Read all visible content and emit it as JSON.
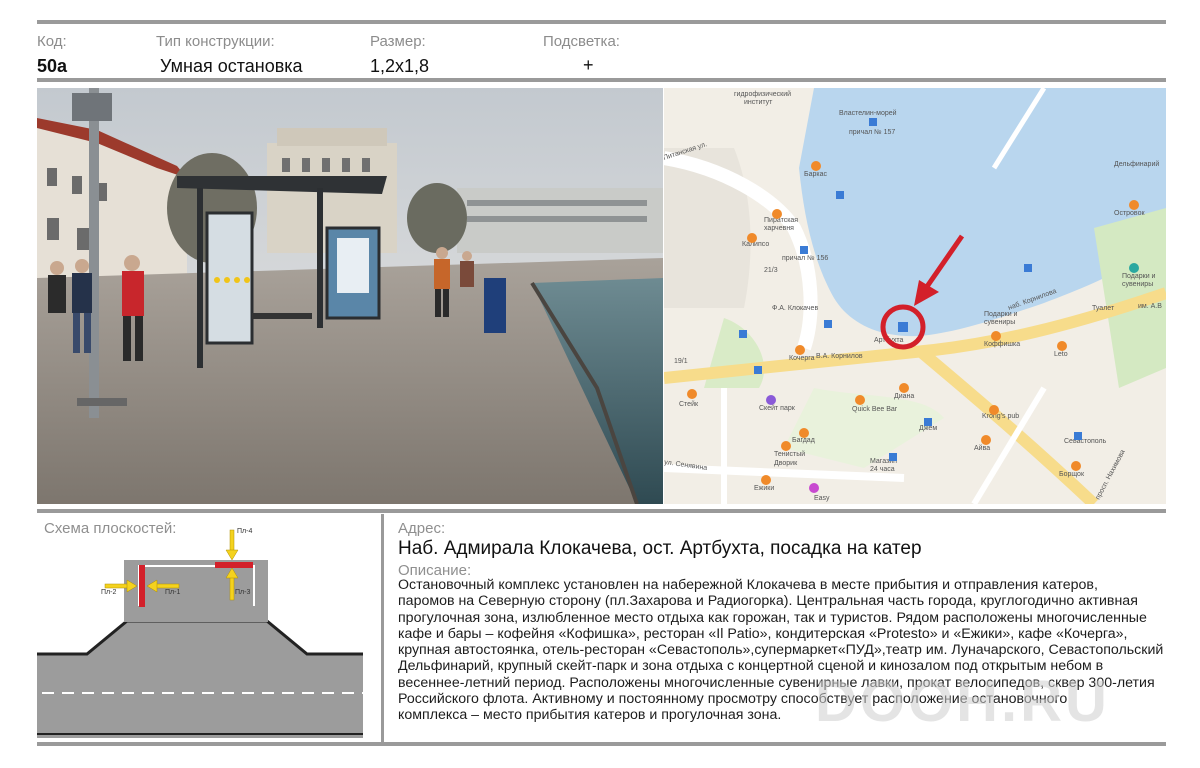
{
  "header": {
    "code_label": "Код:",
    "code_value": "50а",
    "type_label": "Тип конструкции:",
    "type_value": "Умная остановка",
    "size_label": "Размер:",
    "size_value": "1,2х1,8",
    "light_label": "Подсветка:",
    "light_value": "+"
  },
  "scheme": {
    "title": "Схема плоскостей:",
    "planes": [
      "Пл-1",
      "Пл-2",
      "Пл-3",
      "Пл-4"
    ]
  },
  "address": {
    "label": "Адрес:",
    "value": "Наб. Адмирала Клокачева, ост. Артбухта, посадка на катер"
  },
  "description": {
    "label": "Описание:",
    "lines": [
      "Остановочный  комплекс установлен  на набережной Клокачева в месте прибытия и отправления катеров,",
      "паромов на Северную сторону (пл.Захарова и Радиогорка). Центральная часть города,  круглогодично активная",
      "прогулочная зона, излюбленное место отдыха как горожан, так и туристов. Рядом расположены многочисленные",
      "кафе и бары – кофейня «Кофишка», ресторан «Il Patio», кондитерская «Protesto» и «Ежики», кафе «Кочерга»,",
      "крупная автостоянка, отель-ресторан «Севастополь»,супермаркет«ПУД»,театр им. Луначарского, Севастопольский",
      "Дельфинарий, крупный скейт-парк и зона отдыха с концертной сценой и  кинозалом под открытым небом в",
      "весеннее-летний период. Расположены многочисленные сувенирные лавки, прокат велосипедов,  сквер 300-летия",
      "Российского флота. Активному и постоянному просмотру способствует расположение остановочного",
      "комплекса – место прибытия катеров и прогулочная зона."
    ]
  },
  "map": {
    "labels": [
      "гидрофизический институт",
      "Властелин-морей",
      "причал № 157",
      "Питанская ул.",
      "Баркас",
      "Дельфинарий",
      "Островок",
      "Пиратская харчевня",
      "Калипсо",
      "причал № 156",
      "21/3",
      "Ф.А. Клокачев",
      "наб. Корнилова",
      "Подарки и сувениры",
      "Туалет",
      "им. А.В",
      "Артбухта",
      "Кочерга",
      "В.А. Корнилов",
      "Коффишка",
      "Leto",
      "Стейк",
      "Скейт парк",
      "Quick Bee Bar",
      "Диана",
      "Krong's pub",
      "Джем",
      "Багдад",
      "Тенистый Дворик",
      "Магазин 24 часа",
      "Айва",
      "Севастополь",
      "Борщок",
      "Ежики",
      "Easy",
      "ул. Сенявина",
      "просп. Нахимова",
      "19/1"
    ]
  },
  "watermark": "DOOH.RU",
  "colors": {
    "accent_red": "#d3202a",
    "plane_yellow": "#f4d21e",
    "water": "#b9d6ee",
    "bar_grey": "#9a9a9a"
  }
}
